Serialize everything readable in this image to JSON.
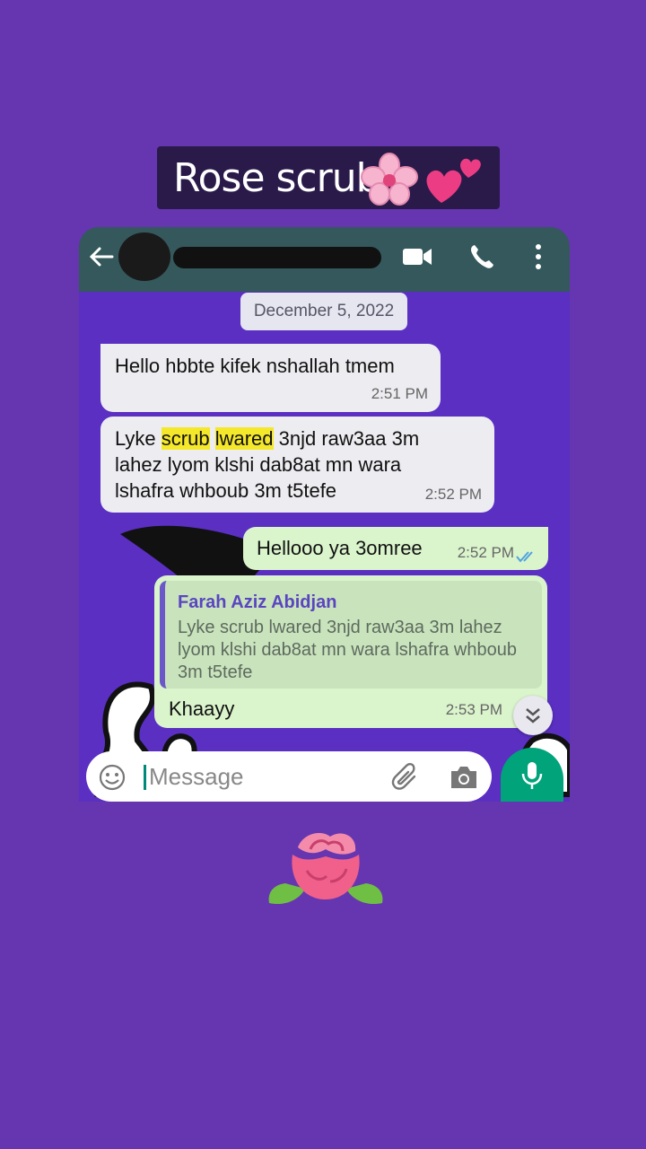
{
  "title": {
    "text": "Rose scrub"
  },
  "colors": {
    "background": "#6636b0",
    "chat_header": "#34585c",
    "incoming_bubble": "#ececf1",
    "outgoing_bubble": "#daf4cc",
    "highlight": "#f5e82a",
    "mic_button": "#00a37a",
    "quote_author": "#5a45c0"
  },
  "icons": {
    "title": [
      "cherry-blossom-icon",
      "two-hearts-icon"
    ],
    "header": [
      "back-arrow-icon",
      "video-call-icon",
      "phone-icon",
      "more-options-icon"
    ],
    "input": [
      "emoji-icon",
      "attach-icon",
      "camera-icon",
      "mic-icon"
    ],
    "decor": "rose-icon"
  },
  "chat": {
    "date": "December 5, 2022",
    "messages": [
      {
        "direction": "in",
        "text": "Hello hbbte kifek nshallah tmem",
        "time": "2:51 PM"
      },
      {
        "direction": "in",
        "text_parts": [
          "Lyke ",
          "scrub",
          " ",
          "lwared",
          " 3njd raw3aa 3m lahez lyom klshi dab8at mn wara lshafra whboub 3m t5tefe"
        ],
        "time": "2:52 PM"
      },
      {
        "direction": "out",
        "text": "Hellooo ya 3omree",
        "time": "2:52 PM",
        "read": true
      },
      {
        "direction": "out",
        "quoted_author": "Farah Aziz Abidjan",
        "quoted_text": "Lyke scrub lwared 3njd raw3aa 3m lahez lyom klshi dab8at mn wara lshafra whboub 3m t5tefe",
        "text": "Khaayy",
        "time": "2:53 PM"
      }
    ]
  },
  "input": {
    "placeholder": "Message"
  }
}
